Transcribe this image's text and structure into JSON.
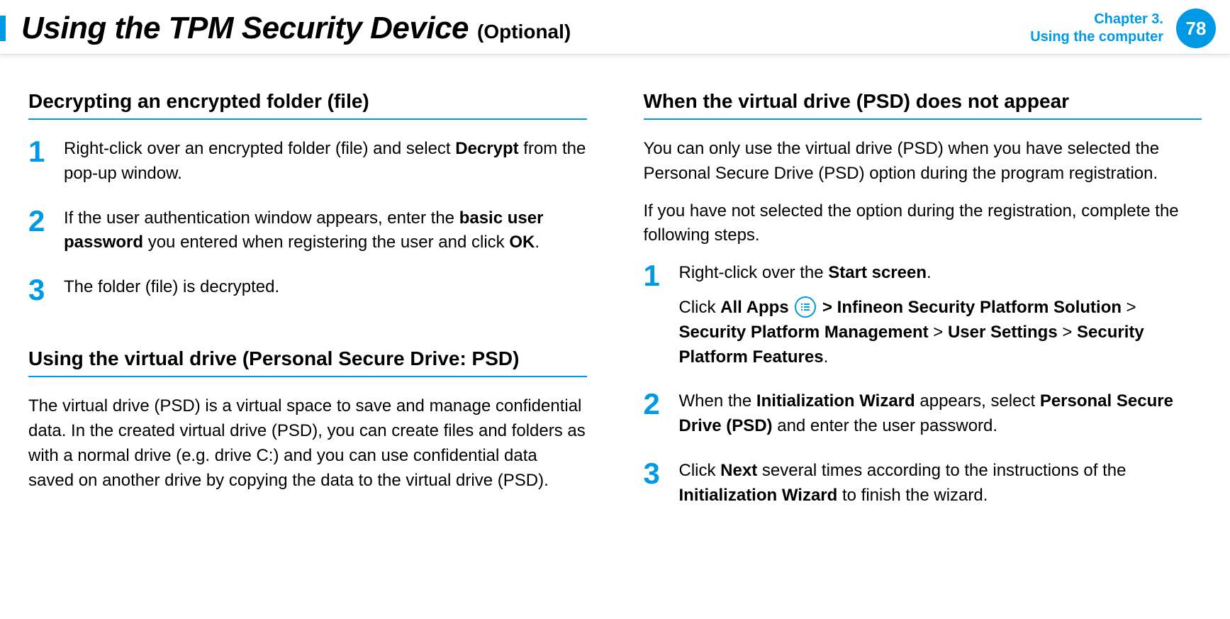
{
  "header": {
    "title": "Using the TPM Security Device",
    "suffix": "(Optional)",
    "chapter_line1": "Chapter 3.",
    "chapter_line2": "Using the computer",
    "page_number": "78"
  },
  "left": {
    "h1": "Decrypting an encrypted folder (file)",
    "step1_a": "Right-click over an encrypted folder (file) and select ",
    "step1_b": "Decrypt",
    "step1_c": " from the pop-up window.",
    "step2_a": "If the user authentication window appears, enter the ",
    "step2_b": "basic user password",
    "step2_c": " you entered when registering the user and click ",
    "step2_d": "OK",
    "step2_e": ".",
    "step3": "The folder (file) is decrypted.",
    "h2": "Using the virtual drive (Personal Secure Drive: PSD)",
    "p1": "The virtual drive (PSD) is a virtual space to save and manage confidential data. In the created virtual drive (PSD), you can create files and folders as with a normal drive (e.g. drive C:) and you can use confidential data saved on another drive by copying the data to the virtual drive (PSD)."
  },
  "right": {
    "h1": "When the virtual drive (PSD) does not appear",
    "p1": "You can only use the virtual drive (PSD) when you have selected the Personal Secure Drive (PSD) option during the program registration.",
    "p2": " If you have not selected the option during the registration, complete the following steps.",
    "step1_a": "Right-click over the ",
    "step1_b": "Start screen",
    "step1_c": ".",
    "step1_sub_a": "Click ",
    "step1_sub_b": "All Apps",
    "step1_sub_c": " > ",
    "step1_sub_d": "Infineon Security Platform Solution",
    "step1_sub_e": " > ",
    "step1_sub_f": "Security Platform Management",
    "step1_sub_g": " > ",
    "step1_sub_h": "User Settings",
    "step1_sub_i": " > ",
    "step1_sub_j": "Security Platform Features",
    "step1_sub_k": ".",
    "step2_a": "When the ",
    "step2_b": "Initialization Wizard",
    "step2_c": " appears, select ",
    "step2_d": "Personal Secure Drive (PSD)",
    "step2_e": " and enter the user password.",
    "step3_a": "Click ",
    "step3_b": "Next",
    "step3_c": " several times according to the instructions of the ",
    "step3_d": "Initialization Wizard",
    "step3_e": " to finish the wizard."
  },
  "nums": {
    "one": "1",
    "two": "2",
    "three": "3"
  }
}
